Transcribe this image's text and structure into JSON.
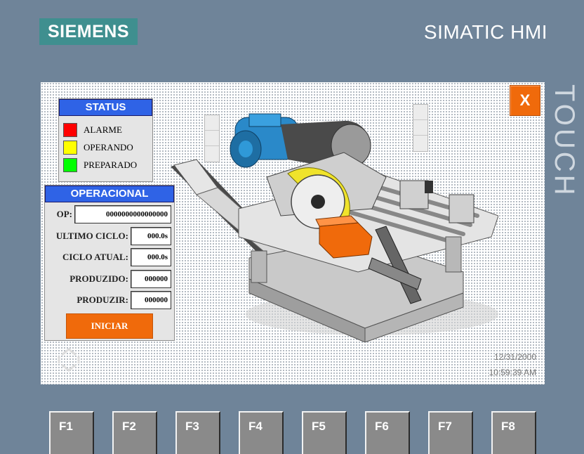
{
  "header": {
    "logo_text": "SIEMENS",
    "product_title": "SIMATIC HMI",
    "touch_label": "TOUCH"
  },
  "screen": {
    "close_label": "X",
    "status": {
      "title": "STATUS",
      "items": [
        {
          "label": "ALARME",
          "color": "#ff0000"
        },
        {
          "label": "OPERANDO",
          "color": "#ffff00"
        },
        {
          "label": "PREPARADO",
          "color": "#00ff00"
        }
      ]
    },
    "operacional": {
      "title": "OPERACIONAL",
      "fields": [
        {
          "label": "OP:",
          "value": "0000000000000000"
        },
        {
          "label": "ULTIMO CICLO:",
          "value": "000.0s"
        },
        {
          "label": "CICLO ATUAL:",
          "value": "000.0s"
        },
        {
          "label": "PRODUZIDO:",
          "value": "000000"
        },
        {
          "label": "PRODUZIR:",
          "value": "000000"
        }
      ],
      "start_label": "INICIAR"
    },
    "footer": {
      "date": "12/31/2000",
      "time": "10:59:39 AM"
    }
  },
  "fkeys": [
    "F1",
    "F2",
    "F3",
    "F4",
    "F5",
    "F6",
    "F7",
    "F8"
  ],
  "colors": {
    "accent": "#f06a0b",
    "header_blue": "#2f63e6",
    "bezel": "#6f8499"
  }
}
